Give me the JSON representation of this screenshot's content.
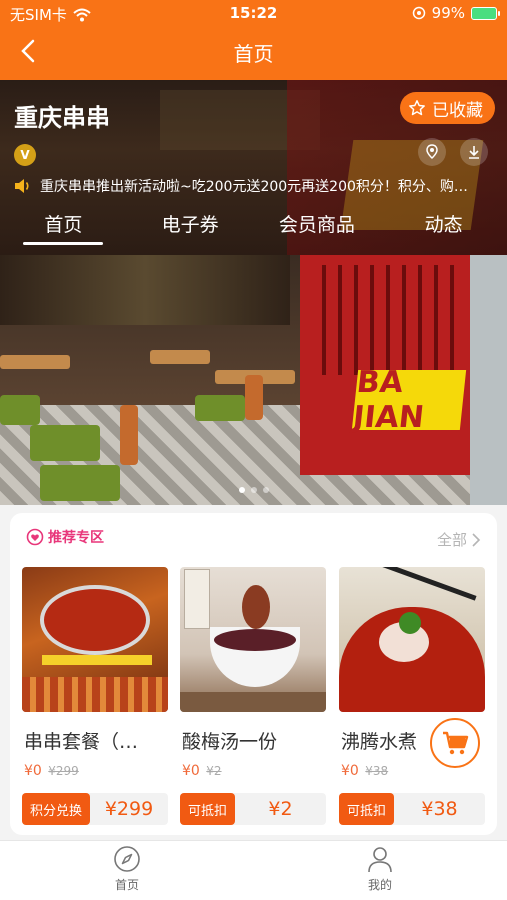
{
  "status_bar": {
    "carrier": "无SIM卡",
    "time": "15:22",
    "battery": "99%"
  },
  "nav": {
    "title": "首页"
  },
  "shop": {
    "name": "重庆串串",
    "fav_label": "已收藏",
    "vip_badge": "V",
    "notice": "重庆串串推出新活动啦~吃200元送200元再送200积分！积分、购…"
  },
  "tabs": [
    {
      "label": "首页",
      "active": true
    },
    {
      "label": "电子券",
      "active": false
    },
    {
      "label": "会员商品",
      "active": false
    },
    {
      "label": "动态",
      "active": false
    }
  ],
  "banner": {
    "sign_text": "BA JIAN",
    "dots": 3,
    "active_dot": 1
  },
  "recommend": {
    "title": "推荐专区",
    "all_label": "全部",
    "products": [
      {
        "name": "串串套餐（…",
        "price": "¥0",
        "orig": "¥299",
        "tag": "积分兑换",
        "value": "¥299"
      },
      {
        "name": "酸梅汤一份",
        "price": "¥0",
        "orig": "¥2",
        "tag": "可抵扣",
        "value": "¥2"
      },
      {
        "name": "沸腾水煮",
        "price": "¥0",
        "orig": "¥38",
        "tag": "可抵扣",
        "value": "¥38"
      }
    ]
  },
  "tabbar": [
    {
      "label": "首页",
      "icon": "compass-icon"
    },
    {
      "label": "我的",
      "icon": "user-icon"
    }
  ],
  "colors": {
    "accent": "#f97316",
    "tag": "#f15a12",
    "pink": "#e8367a"
  }
}
